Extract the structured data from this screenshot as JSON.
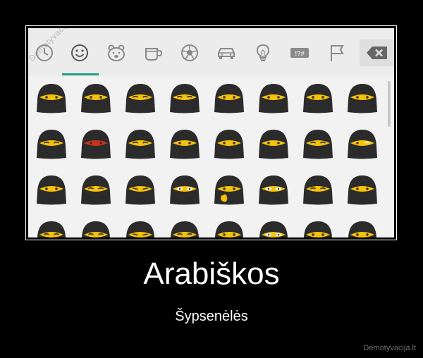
{
  "watermark": "Demotyvacija.lt",
  "keyboard": {
    "tabs": [
      {
        "icon": "clock-icon",
        "active": false
      },
      {
        "icon": "smiley-icon",
        "active": true
      },
      {
        "icon": "bear-icon",
        "active": false
      },
      {
        "icon": "cup-icon",
        "active": false
      },
      {
        "icon": "soccer-ball-icon",
        "active": false
      },
      {
        "icon": "car-icon",
        "active": false
      },
      {
        "icon": "lightbulb-icon",
        "active": false
      },
      {
        "icon": "symbols-icon",
        "active": false
      },
      {
        "icon": "flag-icon",
        "active": false
      }
    ],
    "symbols_label": "!?#",
    "backspace_icon": "backspace-icon",
    "accent_color": "#1f9e82"
  },
  "poster": {
    "title": "Arabiškos",
    "subtitle": "Šypsenėlės",
    "credit": "Demotyvacija.lt"
  }
}
